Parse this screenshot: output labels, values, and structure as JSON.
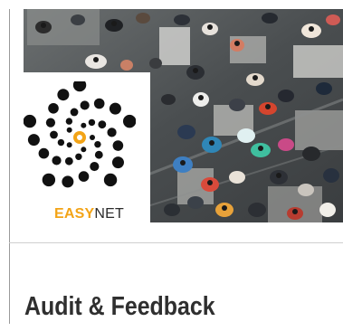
{
  "header": {
    "brand": {
      "part1": "EASY",
      "part2": "NET",
      "accent_color": "#f3a417",
      "text_color": "#2b2b2b",
      "logo_icon": "spiral-dots-logo"
    },
    "banner_image": "crowd-aerial-photo"
  },
  "document": {
    "title": "Audit & Feedback"
  }
}
